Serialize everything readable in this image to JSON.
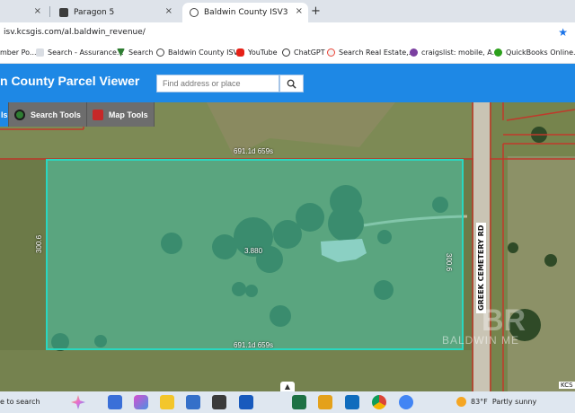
{
  "browser": {
    "tabs": [
      {
        "label": "",
        "active": false
      },
      {
        "label": "Paragon 5",
        "active": false
      },
      {
        "label": "Baldwin County ISV3",
        "active": true
      }
    ],
    "close_glyph": "×",
    "new_tab_glyph": "+",
    "url": "isv.kcsgis.com/al.baldwin_revenue/",
    "bookmarks": [
      "mber Po...",
      "Search - Assurance...",
      "Search",
      "Baldwin County ISV3",
      "YouTube",
      "ChatGPT",
      "Search Real Estate,...",
      "craigslist: mobile, A...",
      "QuickBooks Online..."
    ]
  },
  "app": {
    "title": "n County Parcel Viewer",
    "search_placeholder": "Find address or place",
    "tools": [
      "ls",
      "Search Tools",
      "Map Tools"
    ]
  },
  "map": {
    "labels": {
      "top_measure": "691.1d 659s",
      "bottom_measure": "691.1d 659s",
      "left_measure": "300.6",
      "right_measure": "300.6",
      "parcel_center": "3.880",
      "road": "GREEK CEMETERY RD",
      "attribution": "KCS"
    },
    "watermark": "BALDWIN ME",
    "watermark_logo": "BR",
    "colors": {
      "parcel_fill": "#47d6bc",
      "parcel_border": "#29d7c0",
      "header": "#1e88e5"
    }
  },
  "taskbar": {
    "search_label": "e to search",
    "weather_temp": "83°F",
    "weather_desc": "Partly sunny",
    "icons": [
      "copilot-icon",
      "files-icon",
      "store-icon",
      "word-icon",
      "excel-icon",
      "explorer-icon",
      "outlook-icon",
      "chrome-icon",
      "edge-icon"
    ]
  }
}
